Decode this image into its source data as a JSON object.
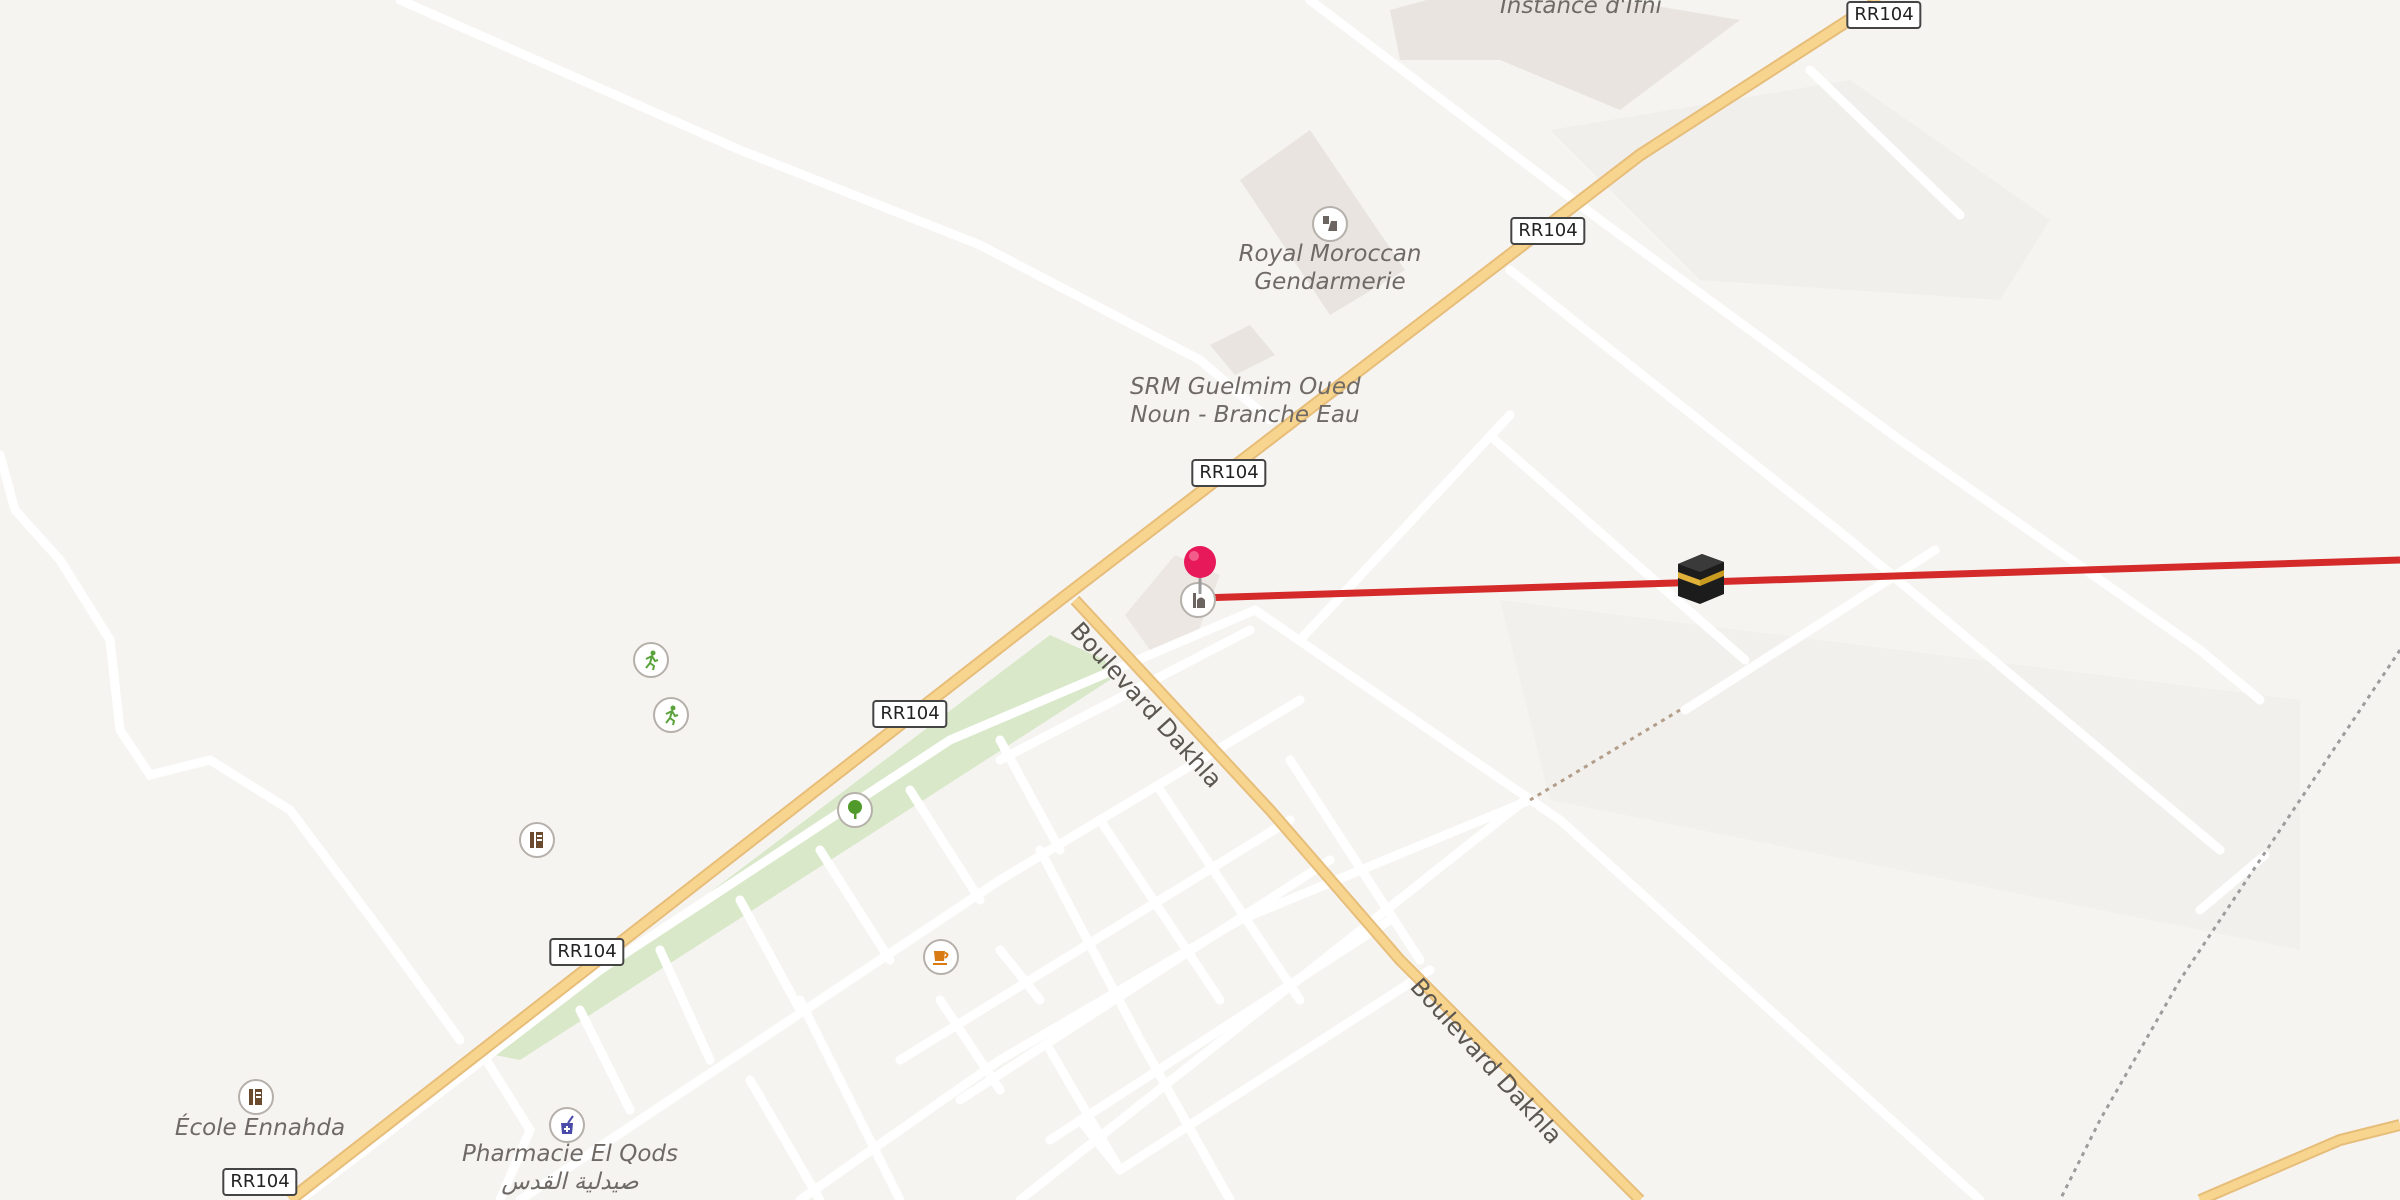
{
  "map": {
    "place_labels": {
      "instance": "Instance d'Ifni",
      "gendarmerie_line1": "Royal Moroccan",
      "gendarmerie_line2": "Gendarmerie",
      "srm_line1": "SRM Guelmim Oued",
      "srm_line2": "Noun - Branche Eau",
      "ecole": "École Ennahda",
      "pharmacie_line1": "Pharmacie El Qods",
      "pharmacie_line2": "صيدلية القدس"
    },
    "road_shield": "RR104",
    "street_name": "Boulevard Dakhla",
    "colors": {
      "background": "#f6f4f1",
      "major_road": "#f7d58f",
      "minor_road": "#ffffff",
      "park": "#d8e8c8",
      "qibla_line": "#d42a2a",
      "pin": "#e8195a"
    },
    "icons": {
      "pin": "location-pin-icon",
      "mosque": "mosque-icon",
      "kaaba": "kaaba-icon",
      "police": "police-icon",
      "sports": "sports-icon",
      "school": "school-icon",
      "park": "tree-icon",
      "cafe": "cafe-icon",
      "pharmacy": "pharmacy-icon"
    }
  }
}
